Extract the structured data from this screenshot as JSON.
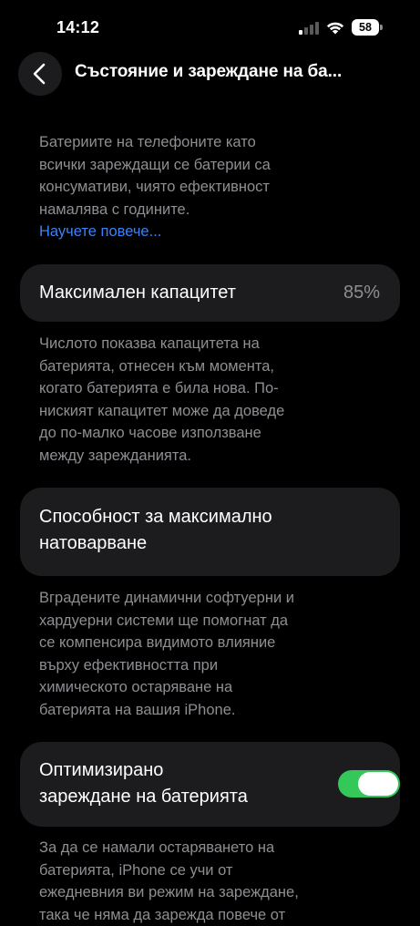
{
  "status_bar": {
    "time": "14:12",
    "battery_level": "58",
    "icons": [
      "cellular-signal-icon",
      "wifi-icon",
      "battery-icon"
    ]
  },
  "nav": {
    "title": "Състояние и зареждане на ба...",
    "back_icon": "chevron-left-icon"
  },
  "intro": {
    "lines": [
      "Батериите на телефоните като",
      "всички зареждащи се батерии са",
      "консумативи, чиято ефективност",
      "намалява с годините."
    ],
    "link": "Научете повече..."
  },
  "max_capacity": {
    "label": "Максимален капацитет",
    "value": "85%",
    "lines": [
      "Числото показва капацитета на",
      "батерията, отнесен към момента,",
      "когато батерията е била нова. По-",
      "ниският капацитет може да доведе",
      "до по-малко часове използване",
      "между зарежданията."
    ]
  },
  "peak_performance": {
    "label_lines": [
      "Способност за максимално",
      "натоварване"
    ],
    "lines": [
      "Вградените динамични софтуерни и",
      "хардуерни системи ще помогнат да",
      "се компенсира видимото влияние",
      "върху ефективността при",
      "химическото остаряване на",
      "батерията на вашия iPhone."
    ]
  },
  "optimized_charging": {
    "label_lines": [
      "Оптимизирано",
      "зареждане на батерията"
    ],
    "toggle_on": true,
    "lines": [
      "За да се намали остаряването на",
      "батерията, iPhone се учи от",
      "ежедневния ви режим на зареждане,",
      "така че няма да зарежда повече от"
    ]
  },
  "colors": {
    "background": "#000000",
    "card": "#1c1c1e",
    "secondary_text": "#8e8e93",
    "link": "#3b82f6",
    "toggle_on": "#34c759"
  }
}
